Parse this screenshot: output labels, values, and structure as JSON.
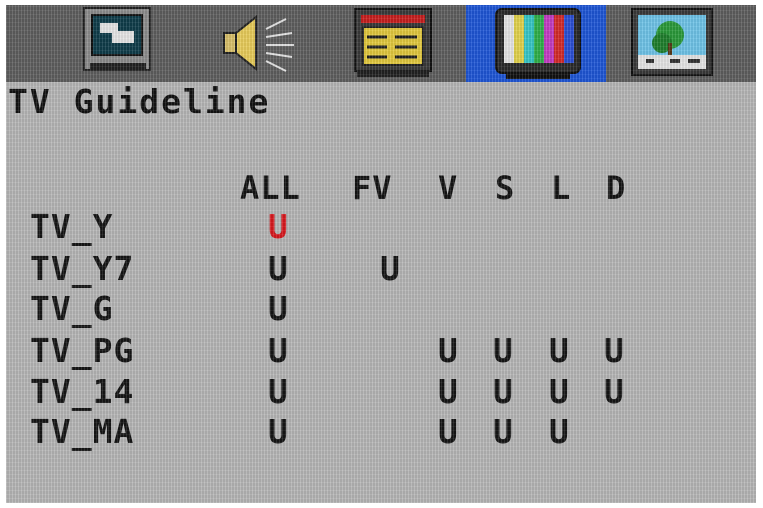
{
  "tabs": [
    {
      "icon": "monitor-icon"
    },
    {
      "icon": "speaker-icon"
    },
    {
      "icon": "feature-settings-icon"
    },
    {
      "icon": "tv-color-bars-icon",
      "active": true
    },
    {
      "icon": "picture-icon"
    }
  ],
  "title": "TV Guideline",
  "columns": [
    "ALL",
    "FV",
    "V",
    "S",
    "L",
    "D"
  ],
  "rows": [
    {
      "label": "TV_Y",
      "cells": [
        "U",
        "",
        "",
        "",
        "",
        ""
      ]
    },
    {
      "label": "TV_Y7",
      "cells": [
        "U",
        "U",
        "",
        "",
        "",
        ""
      ]
    },
    {
      "label": "TV_G",
      "cells": [
        "U",
        "",
        "",
        "",
        "",
        ""
      ]
    },
    {
      "label": "TV_PG",
      "cells": [
        "U",
        "",
        "U",
        "U",
        "U",
        "U"
      ]
    },
    {
      "label": "TV_14",
      "cells": [
        "U",
        "",
        "U",
        "U",
        "U",
        "U"
      ]
    },
    {
      "label": "TV_MA",
      "cells": [
        "U",
        "",
        "U",
        "U",
        "U",
        ""
      ]
    }
  ],
  "selected": {
    "row": 0,
    "col": 0
  },
  "colors": {
    "screen": "#b7b7b7",
    "topbar": "#5f5f5f",
    "active_tab": "#1e56d6",
    "text": "#151515",
    "selected": "#d8191f"
  }
}
